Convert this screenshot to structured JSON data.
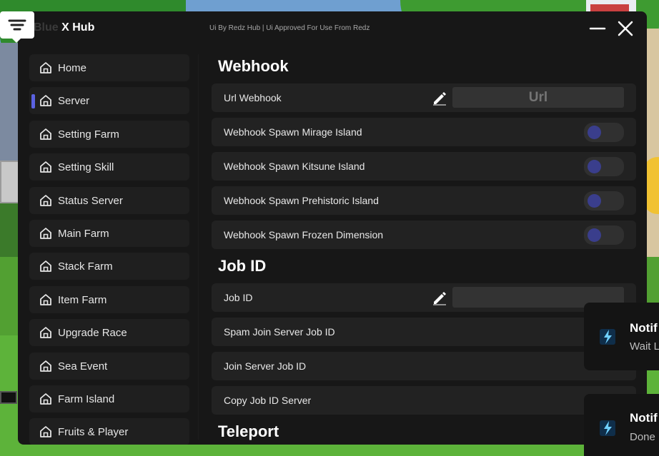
{
  "window": {
    "title_prefix": "Blue",
    "title": "X Hub",
    "subtitle": "Ui By Redz Hub | Ui Approved For Use From Redz"
  },
  "sidebar": {
    "items": [
      {
        "label": "Home",
        "active": false
      },
      {
        "label": "Server",
        "active": true
      },
      {
        "label": "Setting Farm",
        "active": false
      },
      {
        "label": "Setting Skill",
        "active": false
      },
      {
        "label": "Status Server",
        "active": false
      },
      {
        "label": "Main Farm",
        "active": false
      },
      {
        "label": "Stack Farm",
        "active": false
      },
      {
        "label": "Item Farm",
        "active": false
      },
      {
        "label": "Upgrade Race",
        "active": false
      },
      {
        "label": "Sea Event",
        "active": false
      },
      {
        "label": "Farm Island",
        "active": false
      },
      {
        "label": "Fruits & Player",
        "active": false
      }
    ]
  },
  "content": {
    "webhook": {
      "title": "Webhook",
      "url_label": "Url Webhook",
      "url_placeholder": "Url",
      "toggles": [
        {
          "label": "Webhook Spawn Mirage Island",
          "on": false
        },
        {
          "label": "Webhook Spawn Kitsune Island",
          "on": false
        },
        {
          "label": "Webhook Spawn Prehistoric Island",
          "on": false
        },
        {
          "label": "Webhook Spawn Frozen Dimension",
          "on": false
        }
      ]
    },
    "jobid": {
      "title": "Job ID",
      "input_label": "Job ID",
      "input_value": "",
      "buttons": [
        "Spam Join Server Job ID",
        "Join Server Job ID",
        "Copy Job ID Server"
      ]
    },
    "teleport": {
      "title": "Teleport"
    }
  },
  "notifications": [
    {
      "title": "Notif",
      "body": "Wait L"
    },
    {
      "title": "Notif",
      "body": "Done"
    }
  ],
  "colors": {
    "accent": "#5b62e0",
    "panel": "#171717",
    "row": "#222222",
    "toggle_knob": "#3a3e8c"
  },
  "icons": {
    "nav": "home-icon",
    "edit": "pencil-icon",
    "minimize": "minimize-icon",
    "close": "close-icon",
    "menu": "menu-lines-icon",
    "notification": "lightning-logo-icon"
  }
}
